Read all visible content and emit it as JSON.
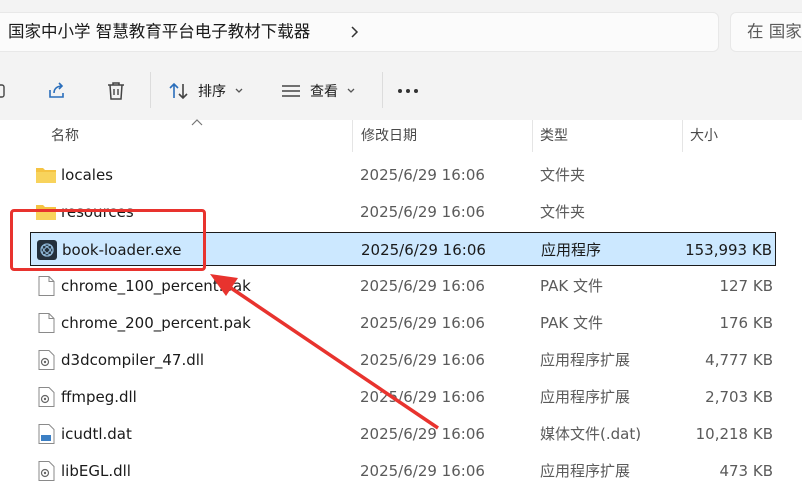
{
  "address": {
    "breadcrumb": "国家中小学 智慧教育平台电子教材下载器",
    "search_placeholder": "在 国家"
  },
  "toolbar": {
    "sort_label": "排序",
    "view_label": "查看"
  },
  "columns": {
    "name": "名称",
    "modified": "修改日期",
    "type": "类型",
    "size": "大小"
  },
  "files": [
    {
      "name": "locales",
      "date": "2025/6/29 16:06",
      "type": "文件夹",
      "size": "",
      "icon": "folder-icon"
    },
    {
      "name": "resources",
      "date": "2025/6/29 16:06",
      "type": "文件夹",
      "size": "",
      "icon": "folder-icon"
    },
    {
      "name": "book-loader.exe",
      "date": "2025/6/29 16:06",
      "type": "应用程序",
      "size": "153,993 KB",
      "icon": "app-icon",
      "selected": true
    },
    {
      "name": "chrome_100_percent.pak",
      "date": "2025/6/29 16:06",
      "type": "PAK 文件",
      "size": "127 KB",
      "icon": "file-icon"
    },
    {
      "name": "chrome_200_percent.pak",
      "date": "2025/6/29 16:06",
      "type": "PAK 文件",
      "size": "176 KB",
      "icon": "file-icon"
    },
    {
      "name": "d3dcompiler_47.dll",
      "date": "2025/6/29 16:06",
      "type": "应用程序扩展",
      "size": "4,777 KB",
      "icon": "dll-icon"
    },
    {
      "name": "ffmpeg.dll",
      "date": "2025/6/29 16:06",
      "type": "应用程序扩展",
      "size": "2,703 KB",
      "icon": "dll-icon"
    },
    {
      "name": "icudtl.dat",
      "date": "2025/6/29 16:06",
      "type": "媒体文件(.dat)",
      "size": "10,218 KB",
      "icon": "media-icon"
    },
    {
      "name": "libEGL.dll",
      "date": "2025/6/29 16:06",
      "type": "应用程序扩展",
      "size": "473 KB",
      "icon": "dll-icon"
    }
  ],
  "colors": {
    "annotation": "#e8332e",
    "selection": "#cce8ff",
    "folder": "#f5c342"
  }
}
